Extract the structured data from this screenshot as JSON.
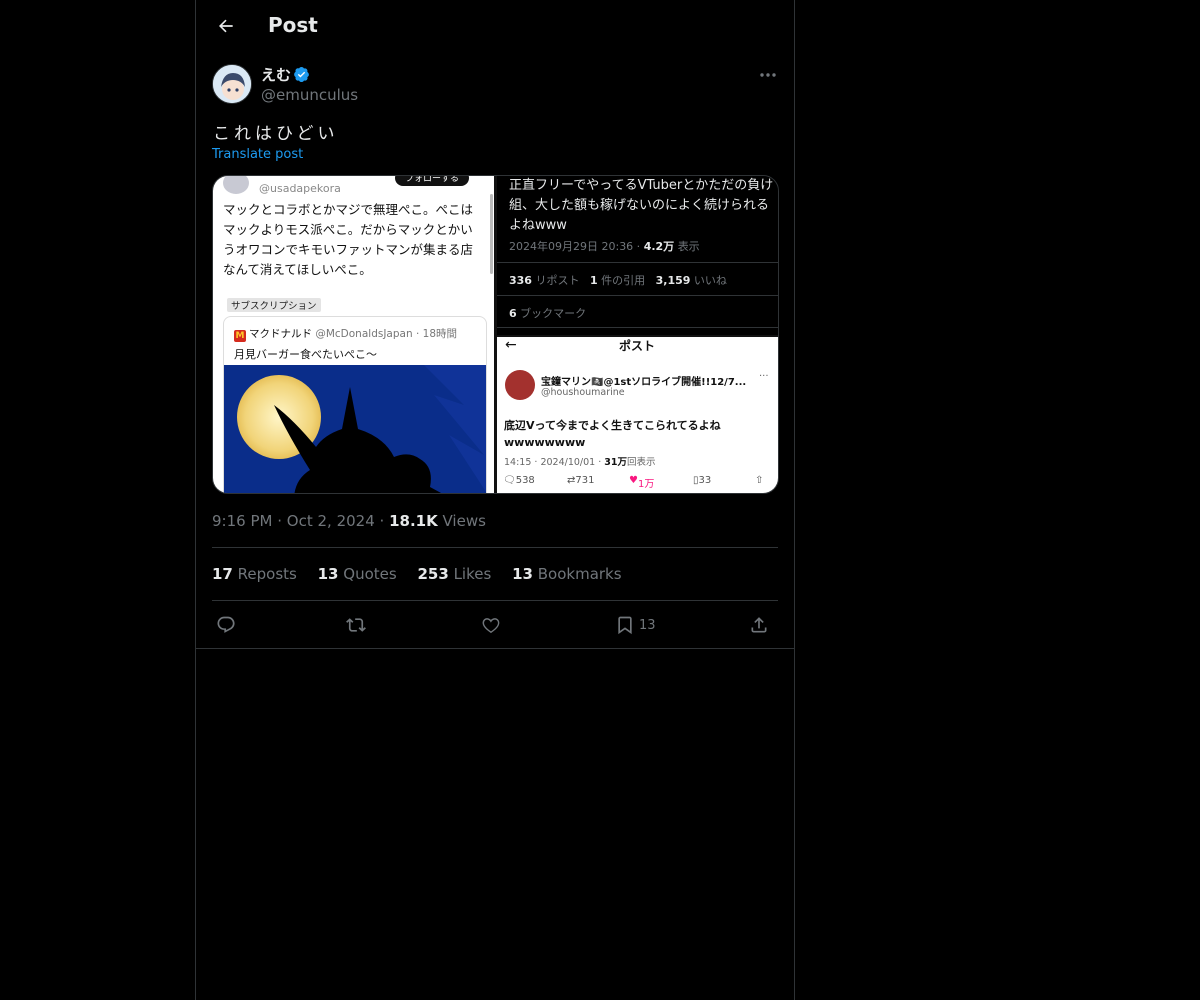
{
  "header": {
    "title": "Post"
  },
  "author": {
    "display_name": "えむ",
    "handle": "@emunculus",
    "verified": true
  },
  "post": {
    "text": "これはひどい",
    "translate_label": "Translate post",
    "time": "9:16 PM",
    "date": "Oct 2, 2024",
    "views_count": "18.1K",
    "views_label": "Views"
  },
  "stats": {
    "reposts_count": "17",
    "reposts_label": "Reposts",
    "quotes_count": "13",
    "quotes_label": "Quotes",
    "likes_count": "253",
    "likes_label": "Likes",
    "bookmarks_count": "13",
    "bookmarks_label": "Bookmarks"
  },
  "actions": {
    "bookmark_count": "13"
  },
  "media": {
    "left": {
      "handle": "@usadapekora",
      "follow": "フォローする",
      "text": "マックとコラボとかマジで無理ぺこ。ぺこはマックよりモス派ぺこ。だからマックとかいうオワコンでキモいファットマンが集まる店なんて消えてほしいぺこ。",
      "subscription": "サブスクリプション",
      "quote_name": "マクドナルド",
      "quote_handle": "@McDonaldsJapan",
      "quote_time": "18時間",
      "quote_text": "月見バーガー食べたいぺこ〜"
    },
    "top_right": {
      "text": "正直フリーでやってるVTuberとかただの負け組、大した額も稼げないのによく続けられるよねwww",
      "date": "2024年09月29日 20:36",
      "views": "4.2万",
      "views_label": "表示",
      "reposts": "336",
      "reposts_label": "リポスト",
      "quotes": "1",
      "quotes_label": "件の引用",
      "likes": "3,159",
      "likes_label": "いいね",
      "bookmarks": "6",
      "bookmarks_label": "ブックマーク"
    },
    "bottom_right": {
      "title": "ポスト",
      "name": "宝鐘マリン🏴‍☠️@1stソロライブ開催!!12/7...",
      "handle": "@houshoumarine",
      "text": "底辺Vって今までよく生きてこられてるよね wwwwwwww",
      "time": "14:15",
      "date": "2024/10/01",
      "views": "31万",
      "views_label": "回表示",
      "replies": "538",
      "reposts": "731",
      "likes": "1万",
      "bookmarks": "33"
    }
  },
  "colors": {
    "accent": "#1d9bf0",
    "muted": "#71767b",
    "text": "#e7e9ea",
    "border": "#2f3336"
  }
}
